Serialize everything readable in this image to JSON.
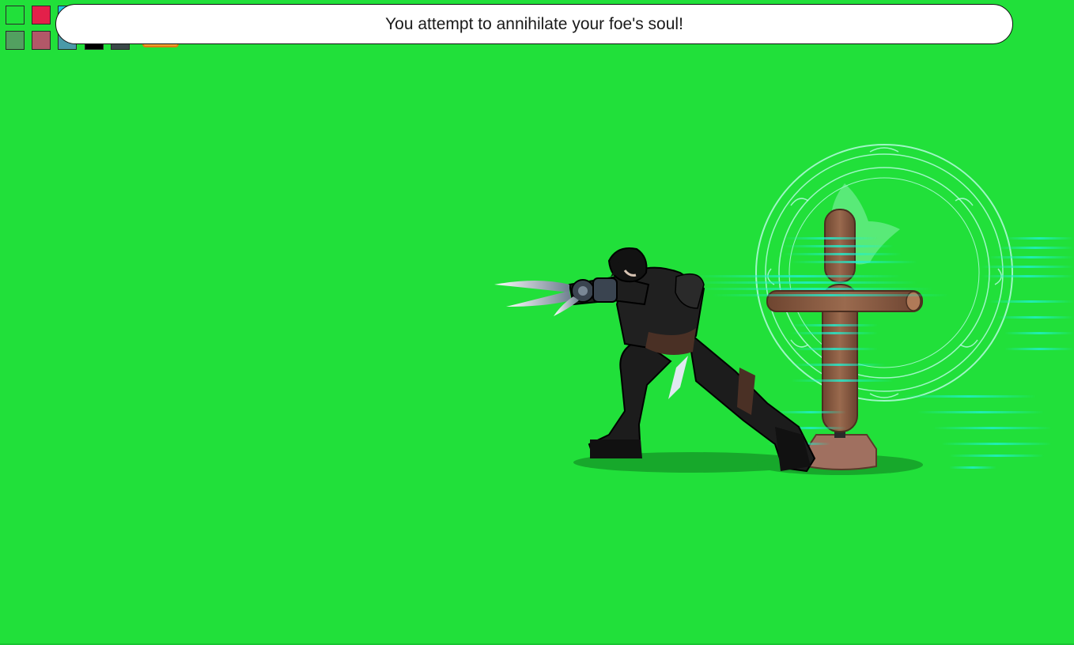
{
  "message": {
    "text": "You attempt to annihilate your foe's soul!"
  },
  "swatches": [
    {
      "name": "swatch-green",
      "color": "#21e03a"
    },
    {
      "name": "swatch-red",
      "color": "#e3204a"
    },
    {
      "name": "swatch-cyan",
      "color": "#1ac8e0"
    },
    {
      "name": "swatch-dull-green",
      "color": "#52a060"
    },
    {
      "name": "swatch-dull-red",
      "color": "#b25868"
    },
    {
      "name": "swatch-teal",
      "color": "#4a9aa8"
    },
    {
      "name": "swatch-black",
      "color": "#000000"
    },
    {
      "name": "swatch-dark-gray",
      "color": "#3a4848"
    }
  ],
  "colors": {
    "background": "#21e03a",
    "energy": "#20f0d0",
    "dummy_wood": "#8a5a40",
    "armor": "#1c1c1c"
  },
  "scene": {
    "player": "dark-armored-warrior",
    "target": "wooden-training-dummy",
    "effect": "soul-rune-circle"
  }
}
